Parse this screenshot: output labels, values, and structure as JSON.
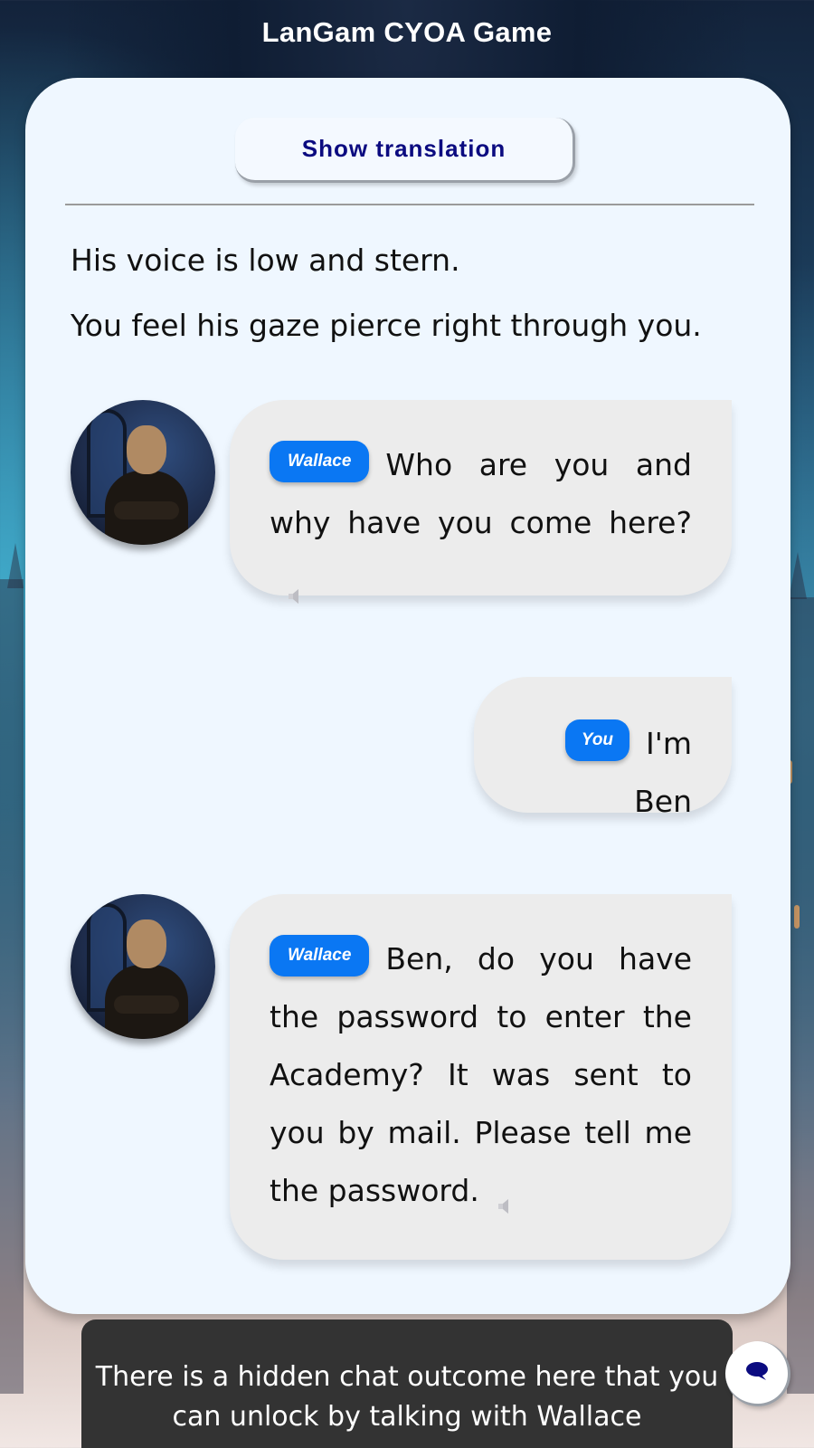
{
  "app": {
    "title": "LanGam CYOA Game"
  },
  "controls": {
    "translation_button": "Show translation"
  },
  "narration": [
    "His voice is low and stern.",
    "You feel his gaze pierce right through you."
  ],
  "messages": [
    {
      "speaker": "Wallace",
      "text": "Who are you and why have you come here?",
      "has_audio": true
    },
    {
      "speaker": "You",
      "text": "I'm Ben",
      "has_audio": false
    },
    {
      "speaker": "Wallace",
      "text": "Ben, do you have the password to enter the Academy? It was sent to you by mail. Please tell me the password.",
      "has_audio": true
    }
  ],
  "toast": {
    "text": "There is a hidden chat outcome here that you can unlock by talking with Wallace"
  },
  "icons": {
    "audio": "speaker-icon",
    "chat": "chat-bubble-icon",
    "avatar": "wallace-portrait"
  },
  "colors": {
    "accent": "#0a77f3",
    "button_text": "#0b0b80",
    "panel": "#eff7ff",
    "bubble": "#ececec",
    "toast": "#333333"
  }
}
